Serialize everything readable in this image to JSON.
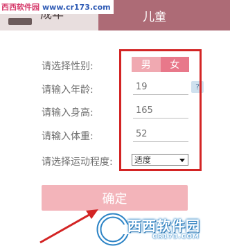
{
  "tabs": {
    "adult_label_partial": "成年",
    "child_label": "儿童"
  },
  "watermark": {
    "site_name": "西西软件园",
    "site_url": "www.cr173.com"
  },
  "form": {
    "gender_label": "请选择性别:",
    "gender_options": [
      "男",
      "女"
    ],
    "gender_selected": "女",
    "age_label": "请输入年龄:",
    "age_value": "19",
    "height_label": "请输入身高:",
    "height_value": "165",
    "weight_label": "请输入体重:",
    "weight_value": "52",
    "activity_label": "请选择运动程度:",
    "activity_selected": "适度"
  },
  "help_glyph": "?",
  "confirm_label": "确定",
  "logo": {
    "text": "西西软件园",
    "url": "CR173.COM"
  },
  "colors": {
    "tab_active": "#ad6b76",
    "gender_male": "#f0a9b1",
    "gender_female": "#e8788a",
    "confirm": "#f3b4ba",
    "highlight": "#d32424"
  }
}
